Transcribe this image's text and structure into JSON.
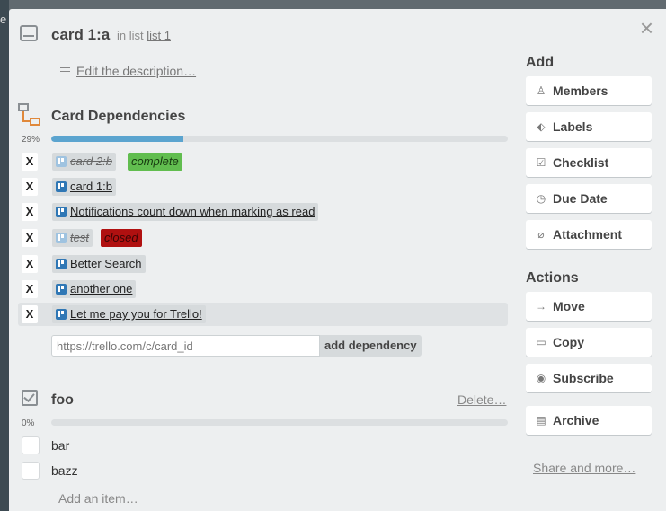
{
  "background": {
    "edge_text": "e"
  },
  "header": {
    "card_title": "card 1:a",
    "in_list_prefix": "in list",
    "list_name": "list 1",
    "close_symbol": "×"
  },
  "description": {
    "link_label": "Edit the description…"
  },
  "dependencies": {
    "title": "Card Dependencies",
    "progress_label": "29%",
    "progress_value": 0.29,
    "remove_symbol": "X",
    "items": [
      {
        "name": "card 2:b",
        "status": "complete",
        "done": true
      },
      {
        "name": "card 1:b",
        "status": "",
        "done": false
      },
      {
        "name": "Notifications count down when marking as read",
        "status": "",
        "done": false
      },
      {
        "name": "test",
        "status": "closed",
        "done": true
      },
      {
        "name": "Better Search",
        "status": "",
        "done": false
      },
      {
        "name": "another one",
        "status": "",
        "done": false
      },
      {
        "name": "Let me pay you for Trello!",
        "status": "",
        "done": false
      }
    ],
    "url_placeholder": "https://trello.com/c/card_id",
    "add_button_label": "add dependency",
    "colors": {
      "progress": "#5ba4cf",
      "complete": "#61bd4f",
      "closed": "#b01010"
    }
  },
  "checklist": {
    "title": "foo",
    "delete_label": "Delete…",
    "progress_label": "0%",
    "progress_value": 0,
    "items": [
      {
        "label": "bar"
      },
      {
        "label": "bazz"
      }
    ],
    "add_item_label": "Add an item…"
  },
  "sidebar": {
    "add_heading": "Add",
    "add_buttons": [
      {
        "label": "Members",
        "icon": "person-icon",
        "glyph": "♙"
      },
      {
        "label": "Labels",
        "icon": "tag-icon",
        "glyph": "⬖"
      },
      {
        "label": "Checklist",
        "icon": "checklist-icon",
        "glyph": "☑"
      },
      {
        "label": "Due Date",
        "icon": "clock-icon",
        "glyph": "◷"
      },
      {
        "label": "Attachment",
        "icon": "paperclip-icon",
        "glyph": "⌀"
      }
    ],
    "actions_heading": "Actions",
    "action_buttons": [
      {
        "label": "Move",
        "icon": "arrow-right-icon",
        "glyph": "→"
      },
      {
        "label": "Copy",
        "icon": "copy-icon",
        "glyph": "▭"
      },
      {
        "label": "Subscribe",
        "icon": "eye-icon",
        "glyph": "◉"
      },
      {
        "label": "Archive",
        "icon": "archive-icon",
        "glyph": "▤"
      }
    ],
    "share_label": "Share and more…"
  }
}
